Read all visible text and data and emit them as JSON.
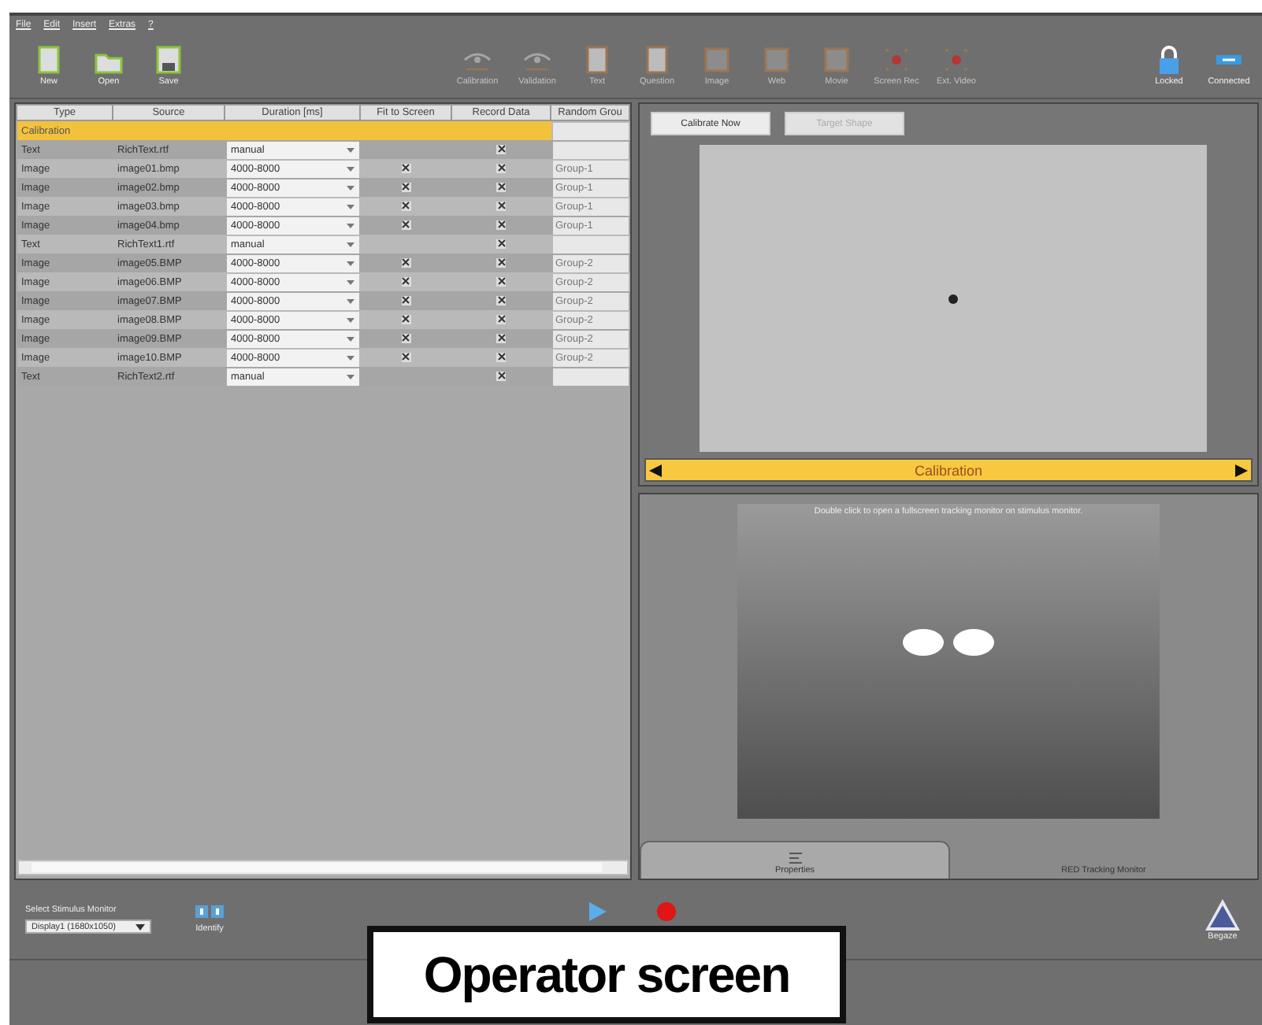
{
  "menu": [
    "File",
    "Edit",
    "Insert",
    "Extras",
    "?"
  ],
  "toolbar": [
    {
      "label": "New",
      "disabled": false
    },
    {
      "label": "Open",
      "disabled": false
    },
    {
      "label": "Save",
      "disabled": false
    },
    {
      "label": "Calibration",
      "disabled": true
    },
    {
      "label": "Validation",
      "disabled": true
    },
    {
      "label": "Text",
      "disabled": true
    },
    {
      "label": "Question",
      "disabled": true
    },
    {
      "label": "Image",
      "disabled": true
    },
    {
      "label": "Web",
      "disabled": true
    },
    {
      "label": "Movie",
      "disabled": true
    },
    {
      "label": "Screen Rec",
      "disabled": true
    },
    {
      "label": "Ext. Video",
      "disabled": true
    }
  ],
  "toolbar_right": [
    {
      "label": "Locked"
    },
    {
      "label": "Connected"
    }
  ],
  "table": {
    "columns": [
      "Type",
      "Source",
      "Duration [ms]",
      "Fit to Screen",
      "Record Data",
      "Random Grou"
    ],
    "rows": [
      {
        "kind": "section",
        "type": "Calibration"
      },
      {
        "kind": "item",
        "type": "Text",
        "source": "RichText.rtf",
        "duration": "manual",
        "fit": false,
        "record": true,
        "group": ""
      },
      {
        "kind": "item",
        "type": "Image",
        "source": "image01.bmp",
        "duration": "4000-8000",
        "fit": true,
        "record": true,
        "group": "Group-1"
      },
      {
        "kind": "item",
        "type": "Image",
        "source": "image02.bmp",
        "duration": "4000-8000",
        "fit": true,
        "record": true,
        "group": "Group-1"
      },
      {
        "kind": "item",
        "type": "Image",
        "source": "image03.bmp",
        "duration": "4000-8000",
        "fit": true,
        "record": true,
        "group": "Group-1"
      },
      {
        "kind": "item",
        "type": "Image",
        "source": "image04.bmp",
        "duration": "4000-8000",
        "fit": true,
        "record": true,
        "group": "Group-1"
      },
      {
        "kind": "item",
        "type": "Text",
        "source": "RichText1.rtf",
        "duration": "manual",
        "fit": false,
        "record": true,
        "group": ""
      },
      {
        "kind": "item",
        "type": "Image",
        "source": "image05.BMP",
        "duration": "4000-8000",
        "fit": true,
        "record": true,
        "group": "Group-2"
      },
      {
        "kind": "item",
        "type": "Image",
        "source": "image06.BMP",
        "duration": "4000-8000",
        "fit": true,
        "record": true,
        "group": "Group-2"
      },
      {
        "kind": "item",
        "type": "Image",
        "source": "image07.BMP",
        "duration": "4000-8000",
        "fit": true,
        "record": true,
        "group": "Group-2"
      },
      {
        "kind": "item",
        "type": "Image",
        "source": "image08.BMP",
        "duration": "4000-8000",
        "fit": true,
        "record": true,
        "group": "Group-2"
      },
      {
        "kind": "item",
        "type": "Image",
        "source": "image09.BMP",
        "duration": "4000-8000",
        "fit": true,
        "record": true,
        "group": "Group-2"
      },
      {
        "kind": "item",
        "type": "Image",
        "source": "image10.BMP",
        "duration": "4000-8000",
        "fit": true,
        "record": true,
        "group": "Group-2"
      },
      {
        "kind": "item",
        "type": "Text",
        "source": "RichText2.rtf",
        "duration": "manual",
        "fit": false,
        "record": true,
        "group": ""
      }
    ]
  },
  "calibration_panel": {
    "buttons": [
      {
        "label": "Calibrate Now",
        "disabled": false
      },
      {
        "label": "Target Shape",
        "disabled": true
      }
    ],
    "nav_title": "Calibration"
  },
  "tracking_panel": {
    "hint": "Double click to open a fullscreen tracking monitor on stimulus monitor.",
    "tabs": [
      {
        "label": "Properties",
        "selected": true
      },
      {
        "label": "RED Tracking Monitor",
        "selected": false
      }
    ]
  },
  "bottom": {
    "monitor_label": "Select Stimulus Monitor",
    "monitor_value": "Display1 (1680x1050)",
    "identify": "Identify",
    "begaze": "Begaze"
  },
  "caption": "Operator screen"
}
